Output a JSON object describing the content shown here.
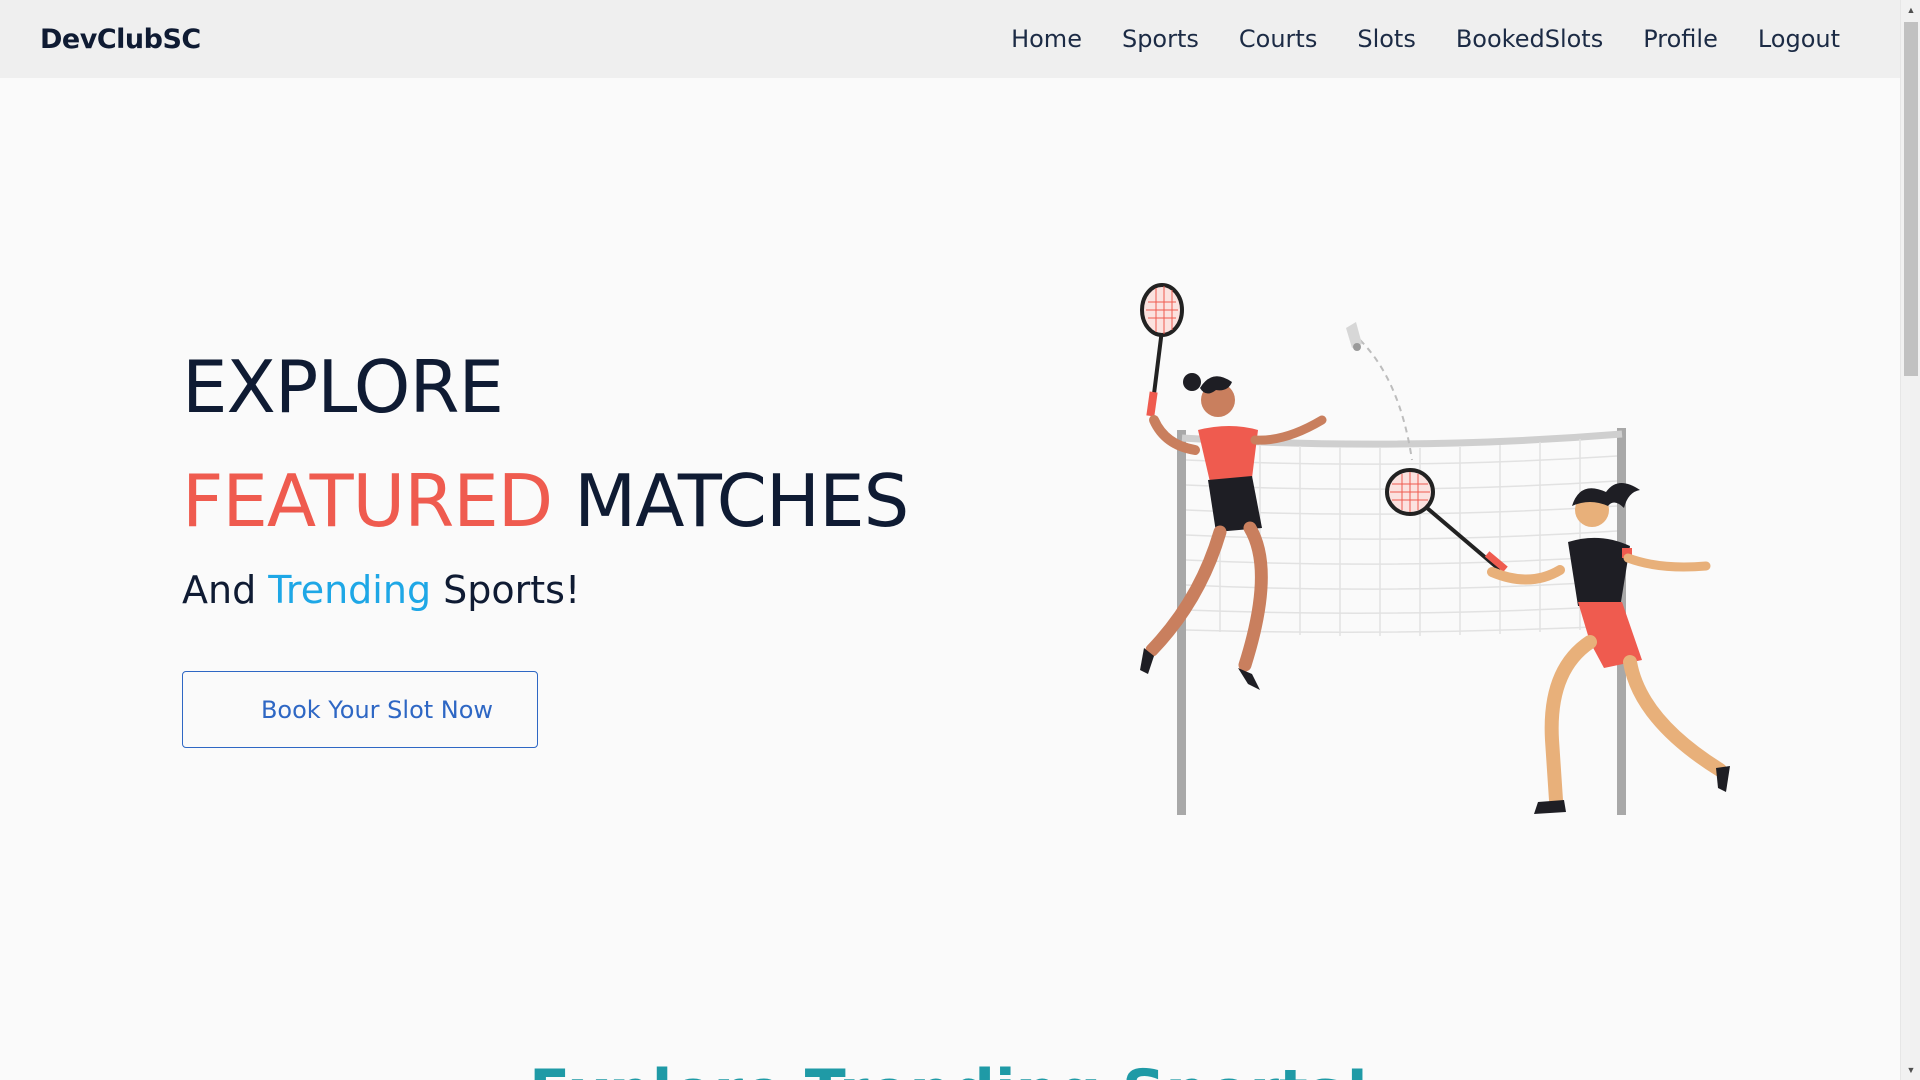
{
  "brand": "DevClubSC",
  "nav": {
    "items": [
      "Home",
      "Sports",
      "Courts",
      "Slots",
      "BookedSlots",
      "Profile",
      "Logout"
    ]
  },
  "hero": {
    "line1": "EXPLORE",
    "line2_accent": "FEATURED",
    "line2_rest": "MATCHES",
    "sub_prefix": "And",
    "sub_accent": "Trending",
    "sub_suffix": "Sports!",
    "cta": "Book Your Slot Now"
  },
  "section": {
    "heading": "Explore Trending Sports!"
  },
  "colors": {
    "navbar_bg": "#efefef",
    "page_bg": "#fafafa",
    "text_dark": "#0f1b33",
    "accent_red": "#ef5b4f",
    "accent_blue": "#1ea7e6",
    "button_blue": "#2e67c4",
    "heading_teal": "#1f9aa6"
  },
  "illustration": {
    "icon": "badminton-players-illustration"
  }
}
